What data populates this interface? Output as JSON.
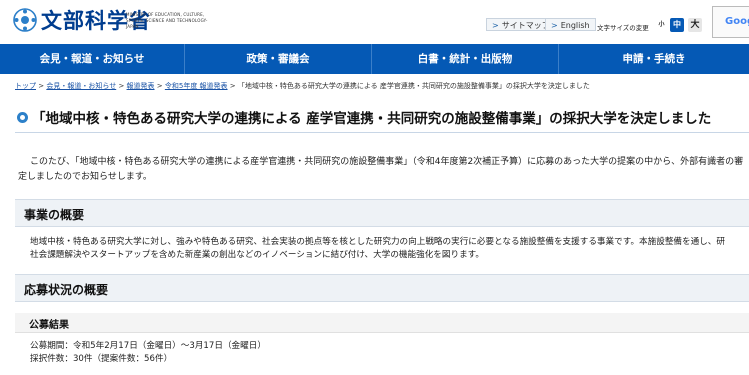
{
  "site": {
    "name_ja": "文部科学省",
    "name_en": "MINISTRY OF EDUCATION, CULTURE, SPORTS, SCIENCE AND TECHNOLOGY-JAPAN"
  },
  "utility": {
    "sitemap": "サイトマップ",
    "english": "English",
    "font_size_label": "文字サイズの変更",
    "font_small": "小",
    "font_medium": "中",
    "font_large": "大",
    "search_placeholder": "Google"
  },
  "gnav": [
    {
      "label": "会見・報道・お知らせ"
    },
    {
      "label": "政策・審議会"
    },
    {
      "label": "白書・統計・出版物"
    },
    {
      "label": "申請・手続き"
    }
  ],
  "breadcrumb": [
    {
      "label": "トップ"
    },
    {
      "label": "会見・報道・お知らせ"
    },
    {
      "label": "報道発表"
    },
    {
      "label": "令和5年度 報道発表"
    }
  ],
  "breadcrumb_current": "「地域中核・特色ある研究大学の連携による 産学官連携・共同研究の施設整備事業」の採択大学を決定しました",
  "page_title": "「地域中核・特色ある研究大学の連携による 産学官連携・共同研究の施設整備事業」の採択大学を決定しました",
  "lead": {
    "line1": "このたび、「地域中核・特色ある研究大学の連携による産学官連携・共同研究の施設整備事業」（令和4年度第2次補正予算）に応募のあった大学の提案の中から、外部有識者の審",
    "line2": "定しましたのでお知らせします。"
  },
  "section_overview": {
    "title": "事業の概要",
    "line1": "地域中核・特色ある研究大学に対し、強みや特色ある研究、社会実装の拠点等を核とした研究力の向上戦略の実行に必要となる施設整備を支援する事業です。本施設整備を通し、研",
    "line2": "社会課題解決やスタートアップを含めた新産業の創出などのイノベーションに結び付け、大学の機能強化を図ります。"
  },
  "section_status": {
    "title": "応募状況の概要",
    "subsection_title": "公募結果",
    "period": "公募期間：令和5年2月17日（金曜日）～3月17日（金曜日）",
    "count": "採択件数：30件（提案件数：56件）"
  }
}
